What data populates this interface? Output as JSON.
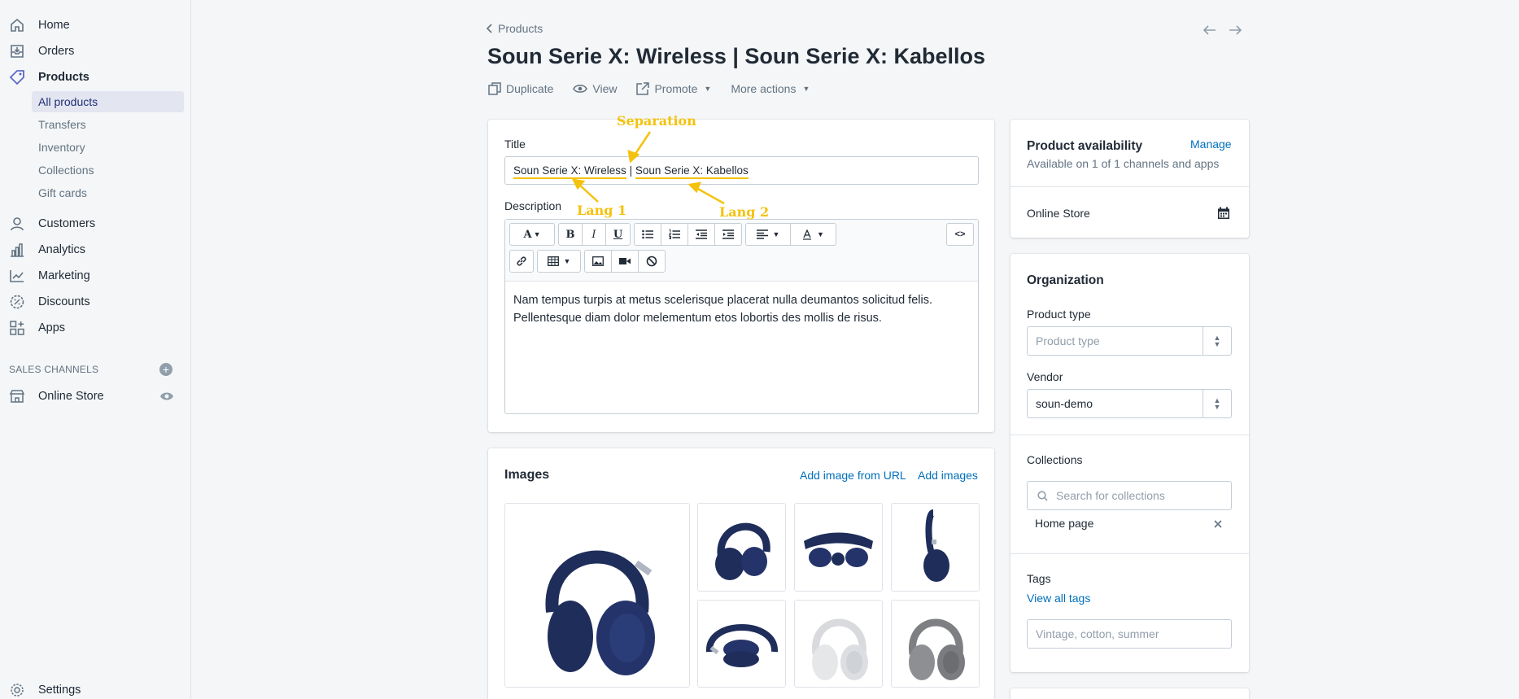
{
  "sidebar": {
    "nav": [
      {
        "label": "Home",
        "icon": "home-icon"
      },
      {
        "label": "Orders",
        "icon": "orders-icon"
      },
      {
        "label": "Products",
        "icon": "products-tag-icon"
      }
    ],
    "products_sub": [
      "All products",
      "Transfers",
      "Inventory",
      "Collections",
      "Gift cards"
    ],
    "nav2": [
      {
        "label": "Customers",
        "icon": "customers-icon"
      },
      {
        "label": "Analytics",
        "icon": "analytics-icon"
      },
      {
        "label": "Marketing",
        "icon": "marketing-icon"
      },
      {
        "label": "Discounts",
        "icon": "discounts-icon"
      },
      {
        "label": "Apps",
        "icon": "apps-icon"
      }
    ],
    "sales_channels_heading": "SALES CHANNELS",
    "online_store": "Online Store",
    "settings": "Settings"
  },
  "header": {
    "breadcrumb": "Products",
    "title": "Soun Serie X: Wireless | Soun Serie X: Kabellos",
    "actions": {
      "duplicate": "Duplicate",
      "view": "View",
      "promote": "Promote",
      "more": "More actions"
    }
  },
  "product": {
    "title_label": "Title",
    "title_part1": "Soun Serie X: Wireless",
    "title_sep": "|",
    "title_part2": "Soun Serie X: Kabellos",
    "description_label": "Description",
    "description_text": "Nam tempus turpis at metus scelerisque placerat nulla deumantos solicitud felis. Pellentesque diam dolor melementum etos lobortis des mollis de risus.",
    "toolbar": {
      "font": "A",
      "bold": "B",
      "italic": "I",
      "underline": "U",
      "code": "<>"
    }
  },
  "annotations": {
    "separation": "Separation",
    "lang1": "Lang 1",
    "lang2": "Lang 2",
    "color": "#f4c20d"
  },
  "images": {
    "title": "Images",
    "add_from_url": "Add image from URL",
    "add_images": "Add images"
  },
  "availability": {
    "title": "Product availability",
    "manage": "Manage",
    "subtitle": "Available on 1 of 1 channels and apps",
    "channel": "Online Store"
  },
  "organization": {
    "title": "Organization",
    "product_type_label": "Product type",
    "product_type_placeholder": "Product type",
    "vendor_label": "Vendor",
    "vendor_value": "soun-demo",
    "collections_label": "Collections",
    "collections_placeholder": "Search for collections",
    "collection_item": "Home page",
    "tags_label": "Tags",
    "view_all_tags": "View all tags",
    "tags_placeholder": "Vintage, cotton, summer"
  },
  "colors": {
    "accent_link": "#006fbb",
    "headphone_blue": "#1f2d5a",
    "selected_nav_bg": "#e3e6f0"
  }
}
